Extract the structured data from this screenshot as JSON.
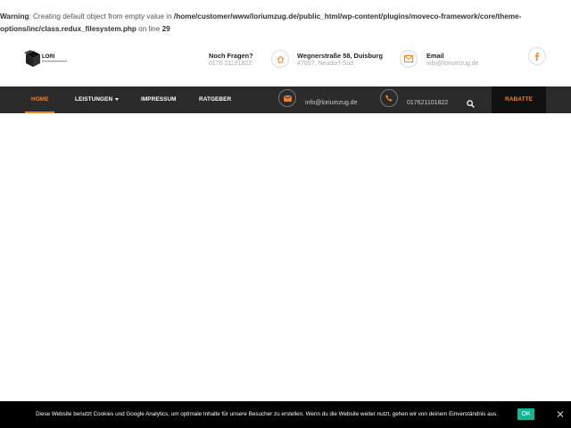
{
  "warning": {
    "label": "Warning",
    "text1": ": Creating default object from empty value in ",
    "path": "/home/customer/www/loriumzug.de/public_html/wp-content/plugins/moveco-framework/core/theme-options/inc/class.redux_filesystem.php",
    "text2": " on line ",
    "line": "29"
  },
  "logo": {
    "text": "LORI"
  },
  "header": {
    "contact1": {
      "title": "Noch Fragen?",
      "sub": "0176 21101822",
      "icon": "phone-icon"
    },
    "contact2": {
      "title": "Wegnerstraße 58, Duisburg",
      "sub": "47057, Neudorf-Süd",
      "icon": "home-icon"
    },
    "contact3": {
      "title": "Email",
      "sub": "info@loriumzug.de",
      "icon": "envelope-icon"
    },
    "social": {
      "icon": "facebook-icon"
    }
  },
  "nav": {
    "items": [
      {
        "label": "HOME"
      },
      {
        "label": "LEISTUNGEN"
      },
      {
        "label": "IMPRESSUM"
      },
      {
        "label": "RATGEBER"
      }
    ],
    "email": "info@loriumzug.de",
    "phone": "017621101822",
    "rabatte": "RABATTE"
  },
  "cookie": {
    "text": "Diese Website benutzt Cookies und Google Analytics, um optimale Inhalte für unsere Besucher zu erstellen. Wenn du die Website weiter nutzt, gehen wir von deinem Einverständnis aus.",
    "ok": "OK"
  },
  "colors": {
    "accent": "#f58220",
    "navbar": "#2b2b2b",
    "ok": "#19b394"
  }
}
